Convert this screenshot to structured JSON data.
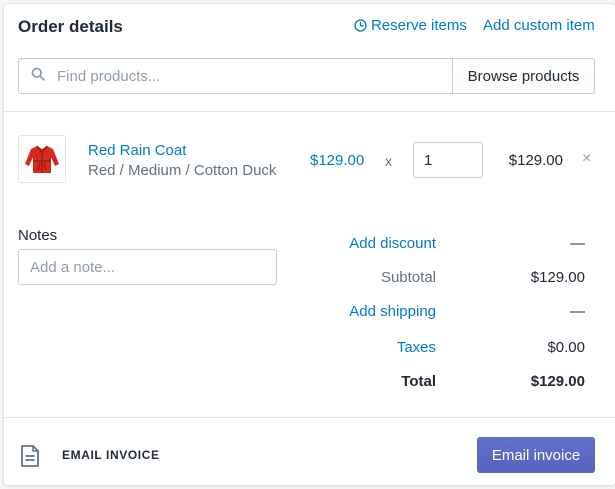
{
  "header": {
    "title": "Order details",
    "reserve_label": "Reserve items",
    "custom_item_label": "Add custom item"
  },
  "search": {
    "placeholder": "Find products...",
    "browse_label": "Browse products"
  },
  "line_items": [
    {
      "name": "Red Rain Coat",
      "variant": "Red / Medium / Cotton Duck",
      "unit_price": "$129.00",
      "times": "x",
      "quantity": "1",
      "line_total": "$129.00",
      "remove_glyph": "×"
    }
  ],
  "notes": {
    "label": "Notes",
    "placeholder": "Add a note..."
  },
  "summary": {
    "discount_label": "Add discount",
    "discount_value": "—",
    "subtotal_label": "Subtotal",
    "subtotal_value": "$129.00",
    "shipping_label": "Add shipping",
    "shipping_value": "—",
    "taxes_label": "Taxes",
    "taxes_value": "$0.00",
    "total_label": "Total",
    "total_value": "$129.00"
  },
  "footer": {
    "email_label": "EMAIL INVOICE",
    "email_button": "Email invoice"
  },
  "colors": {
    "link": "#007ace",
    "primary": "#5c6ac4",
    "text": "#212b36",
    "muted": "#637381",
    "border": "#c4cdd5"
  },
  "icons": [
    "clock-icon",
    "search-icon",
    "product-thumbnail",
    "close-icon",
    "document-icon"
  ]
}
